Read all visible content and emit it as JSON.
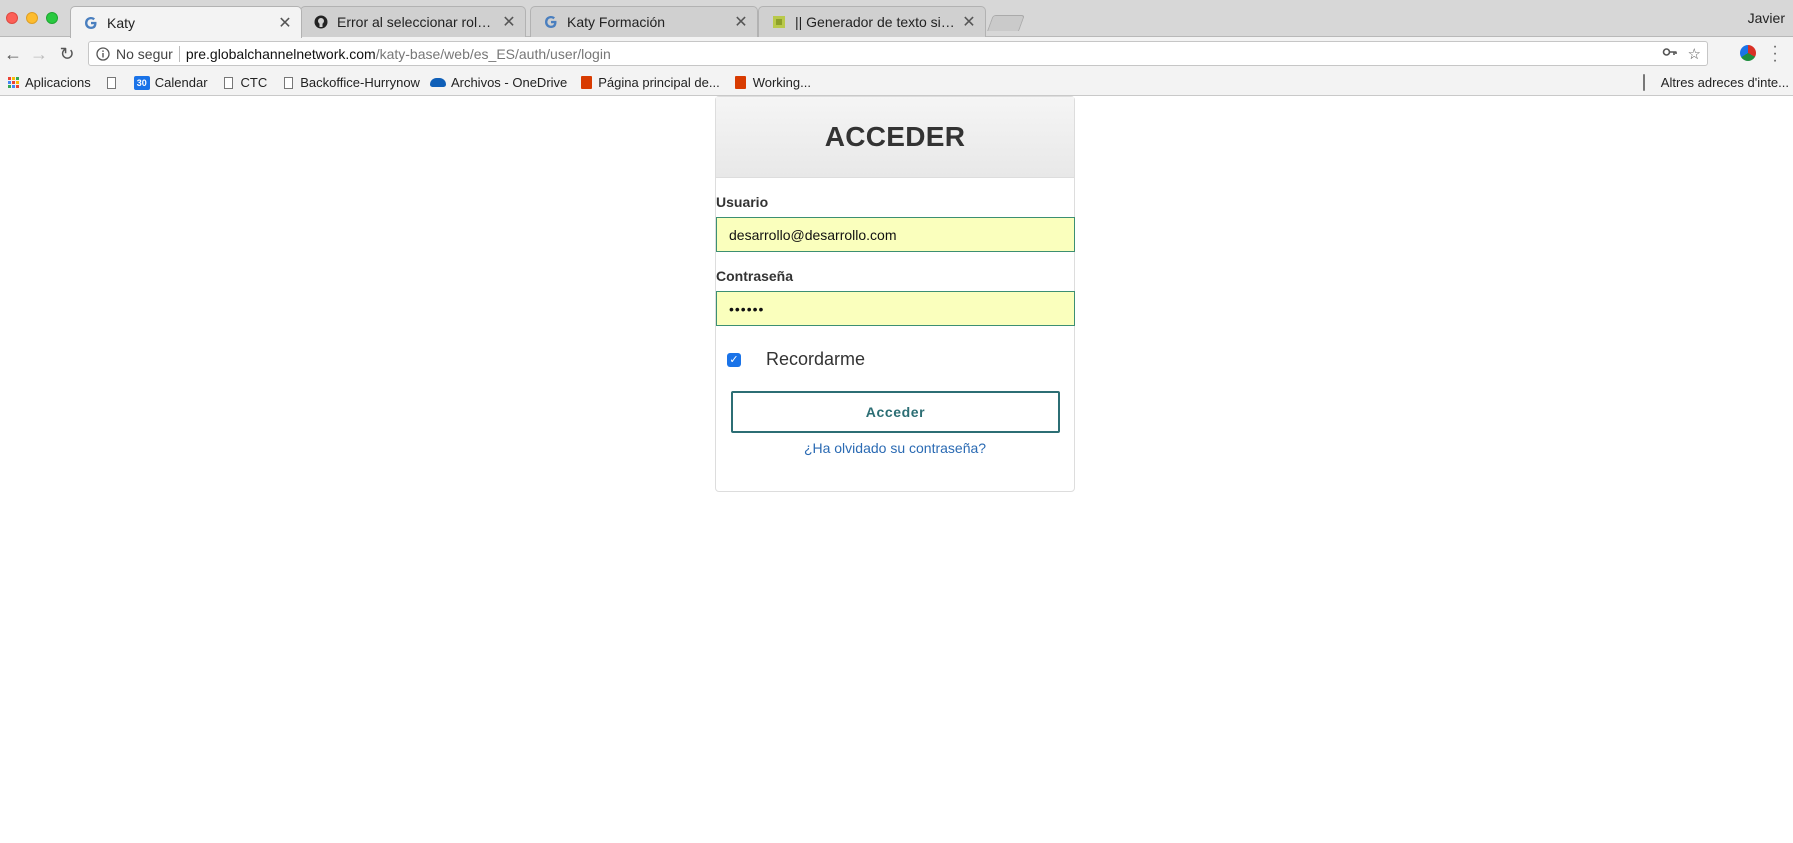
{
  "browser": {
    "tabs": [
      {
        "title": "Katy",
        "favicon": "google-icon",
        "active": true
      },
      {
        "title": "Error al seleccionar roles · Issu",
        "favicon": "github-icon",
        "active": false
      },
      {
        "title": "Katy Formación",
        "favicon": "google-icon",
        "active": false
      },
      {
        "title": "|| Generador de texto simulado",
        "favicon": "lorem-site-icon",
        "active": false
      }
    ],
    "tab_close_glyph": "✕",
    "profile_name": "Javier",
    "address": {
      "security_label": "No segur",
      "host": "pre.globalchannelnetwork.com",
      "path": "/katy-base/web/es_ES/auth/user/login"
    },
    "bookmarks": [
      {
        "label": "Aplicacions",
        "icon": "apps-grid-icon"
      },
      {
        "label": "",
        "icon": "page-icon"
      },
      {
        "label": "Calendar",
        "icon": "calendar-icon"
      },
      {
        "label": "CTC",
        "icon": "page-icon"
      },
      {
        "label": "Backoffice-Hurrynow",
        "icon": "page-icon"
      },
      {
        "label": "Archivos - OneDrive",
        "icon": "onedrive-icon"
      },
      {
        "label": "Página principal de...",
        "icon": "office-icon"
      },
      {
        "label": "Working...",
        "icon": "office-icon"
      }
    ],
    "calendar_icon_text": "30",
    "other_bookmarks": "Altres adreces d'inte..."
  },
  "login": {
    "title": "ACCEDER",
    "username_label": "Usuario",
    "username_value": "desarrollo@desarrollo.com",
    "password_label": "Contraseña",
    "password_value": "••••••",
    "remember_label": "Recordarme",
    "remember_checked": true,
    "submit_label": "Acceder",
    "forgot_link": "¿Ha olvidado su contraseña?"
  },
  "colors": {
    "autofill_bg": "#faffbd",
    "accent": "#2c6e74",
    "link": "#2a6ab3"
  }
}
